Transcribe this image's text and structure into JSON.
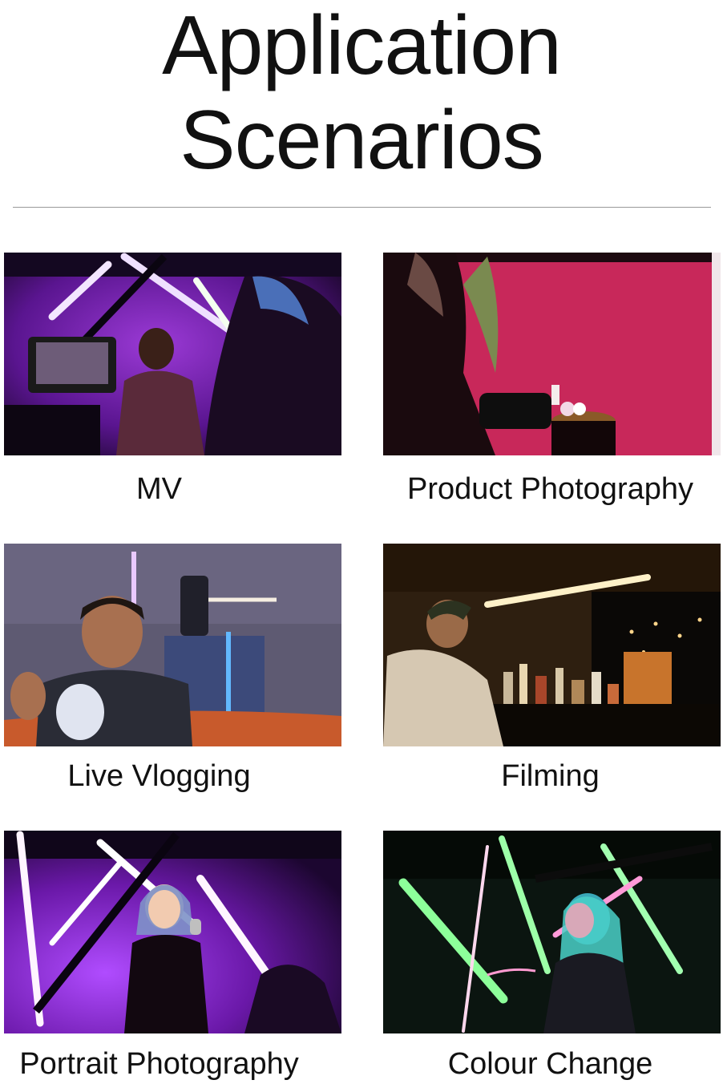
{
  "heading": {
    "line1": "Application",
    "line2": "Scenarios"
  },
  "scenarios": [
    {
      "label": "MV",
      "image_icon": "mv-scene-image",
      "tint": "#6a1fa0"
    },
    {
      "label": "Product Photography",
      "image_icon": "product-photo-scene-image",
      "tint": "#d0305e"
    },
    {
      "label": "Live Vlogging",
      "image_icon": "vlogging-scene-image",
      "tint": "#5a566e"
    },
    {
      "label": "Filming",
      "image_icon": "filming-scene-image",
      "tint": "#3a2510"
    },
    {
      "label": "Portrait Photography",
      "image_icon": "portrait-photo-scene-image",
      "tint": "#7a1fa8"
    },
    {
      "label": "Colour Change",
      "image_icon": "colour-change-scene-image",
      "tint": "#0c1a10"
    }
  ]
}
